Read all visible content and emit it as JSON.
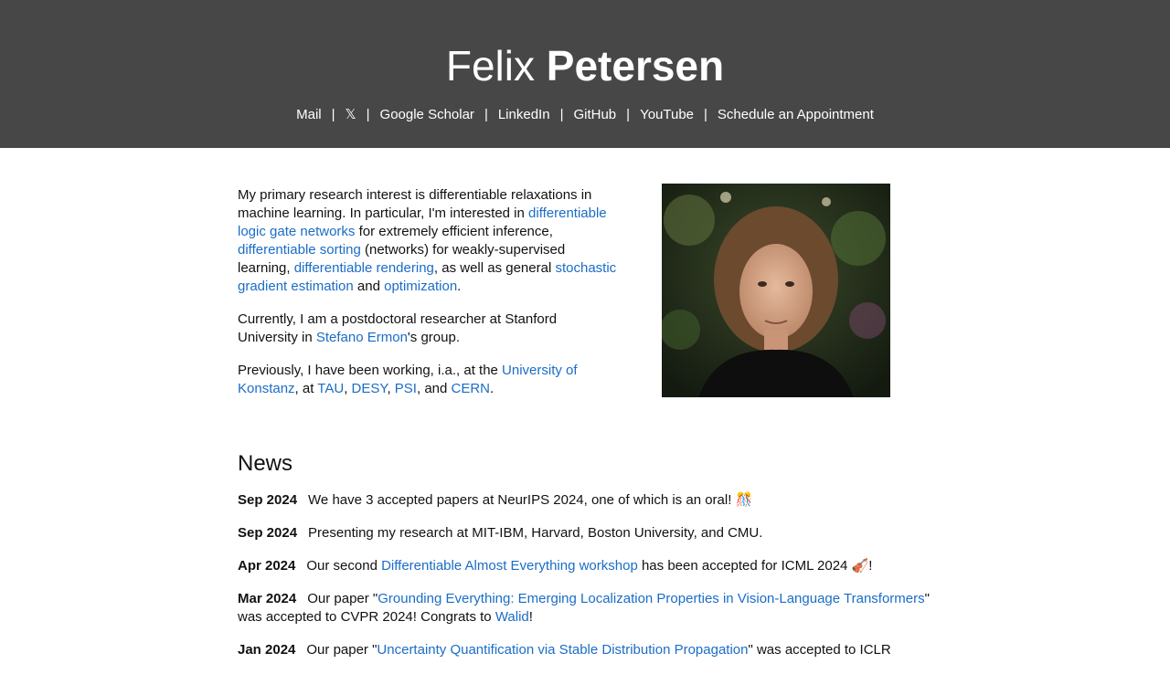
{
  "header": {
    "first_name": "Felix",
    "last_name": "Petersen",
    "nav": [
      "Mail",
      "𝕏",
      "Google Scholar",
      "LinkedIn",
      "GitHub",
      "YouTube",
      "Schedule an Appointment"
    ],
    "separator": "|"
  },
  "intro": {
    "p1": {
      "t1": "My primary research interest is differentiable relaxations in machine learning. In particular, I'm interested in ",
      "l1": "differentiable logic gate networks",
      "t2": " for extremely efficient inference, ",
      "l2": "differentiable sorting",
      "t3": " (networks) for weakly-supervised learning, ",
      "l3": "differentiable rendering",
      "t4": ", as well as general ",
      "l4": "stochastic gradient estimation",
      "t5": " and ",
      "l5": "optimization",
      "t6": "."
    },
    "p2": {
      "t1": "Currently, I am a postdoctoral researcher at Stanford University in ",
      "l1": "Stefano Ermon",
      "t2": "'s group."
    },
    "p3": {
      "t1": "Previously, I have been working, i.a., at the ",
      "l1": "University of Konstanz",
      "t2": ", at ",
      "l2": "TAU",
      "t3": ", ",
      "l3": "DESY",
      "t4": ", ",
      "l4": "PSI",
      "t5": ", and ",
      "l5": "CERN",
      "t6": "."
    }
  },
  "news": {
    "title": "News",
    "items": [
      {
        "date": "Sep 2024",
        "t1": "We have 3 accepted papers at NeurIPS 2024, one of which is an oral! 🎊"
      },
      {
        "date": "Sep 2024",
        "t1": "Presenting my research at MIT-IBM, Harvard, Boston University, and CMU."
      },
      {
        "date": "Apr 2024",
        "t1": "Our second ",
        "l1": "Differentiable Almost Everything workshop",
        "t2": " has been accepted for ICML 2024 🎻!"
      },
      {
        "date": "Mar 2024",
        "t1": "Our paper \"",
        "l1": "Grounding Everything: Emerging Localization Properties in Vision-Language Transformers",
        "t2": "\" was accepted to CVPR 2024! Congrats to ",
        "l2": "Walid",
        "t3": "!"
      },
      {
        "date": "Jan 2024",
        "t1": "Our paper \"",
        "l1": "Uncertainty Quantification via Stable Distribution Propagation",
        "t2": "\" was accepted to ICLR"
      }
    ]
  },
  "colors": {
    "header_bg": "#474747",
    "link": "#1a6dc7"
  }
}
